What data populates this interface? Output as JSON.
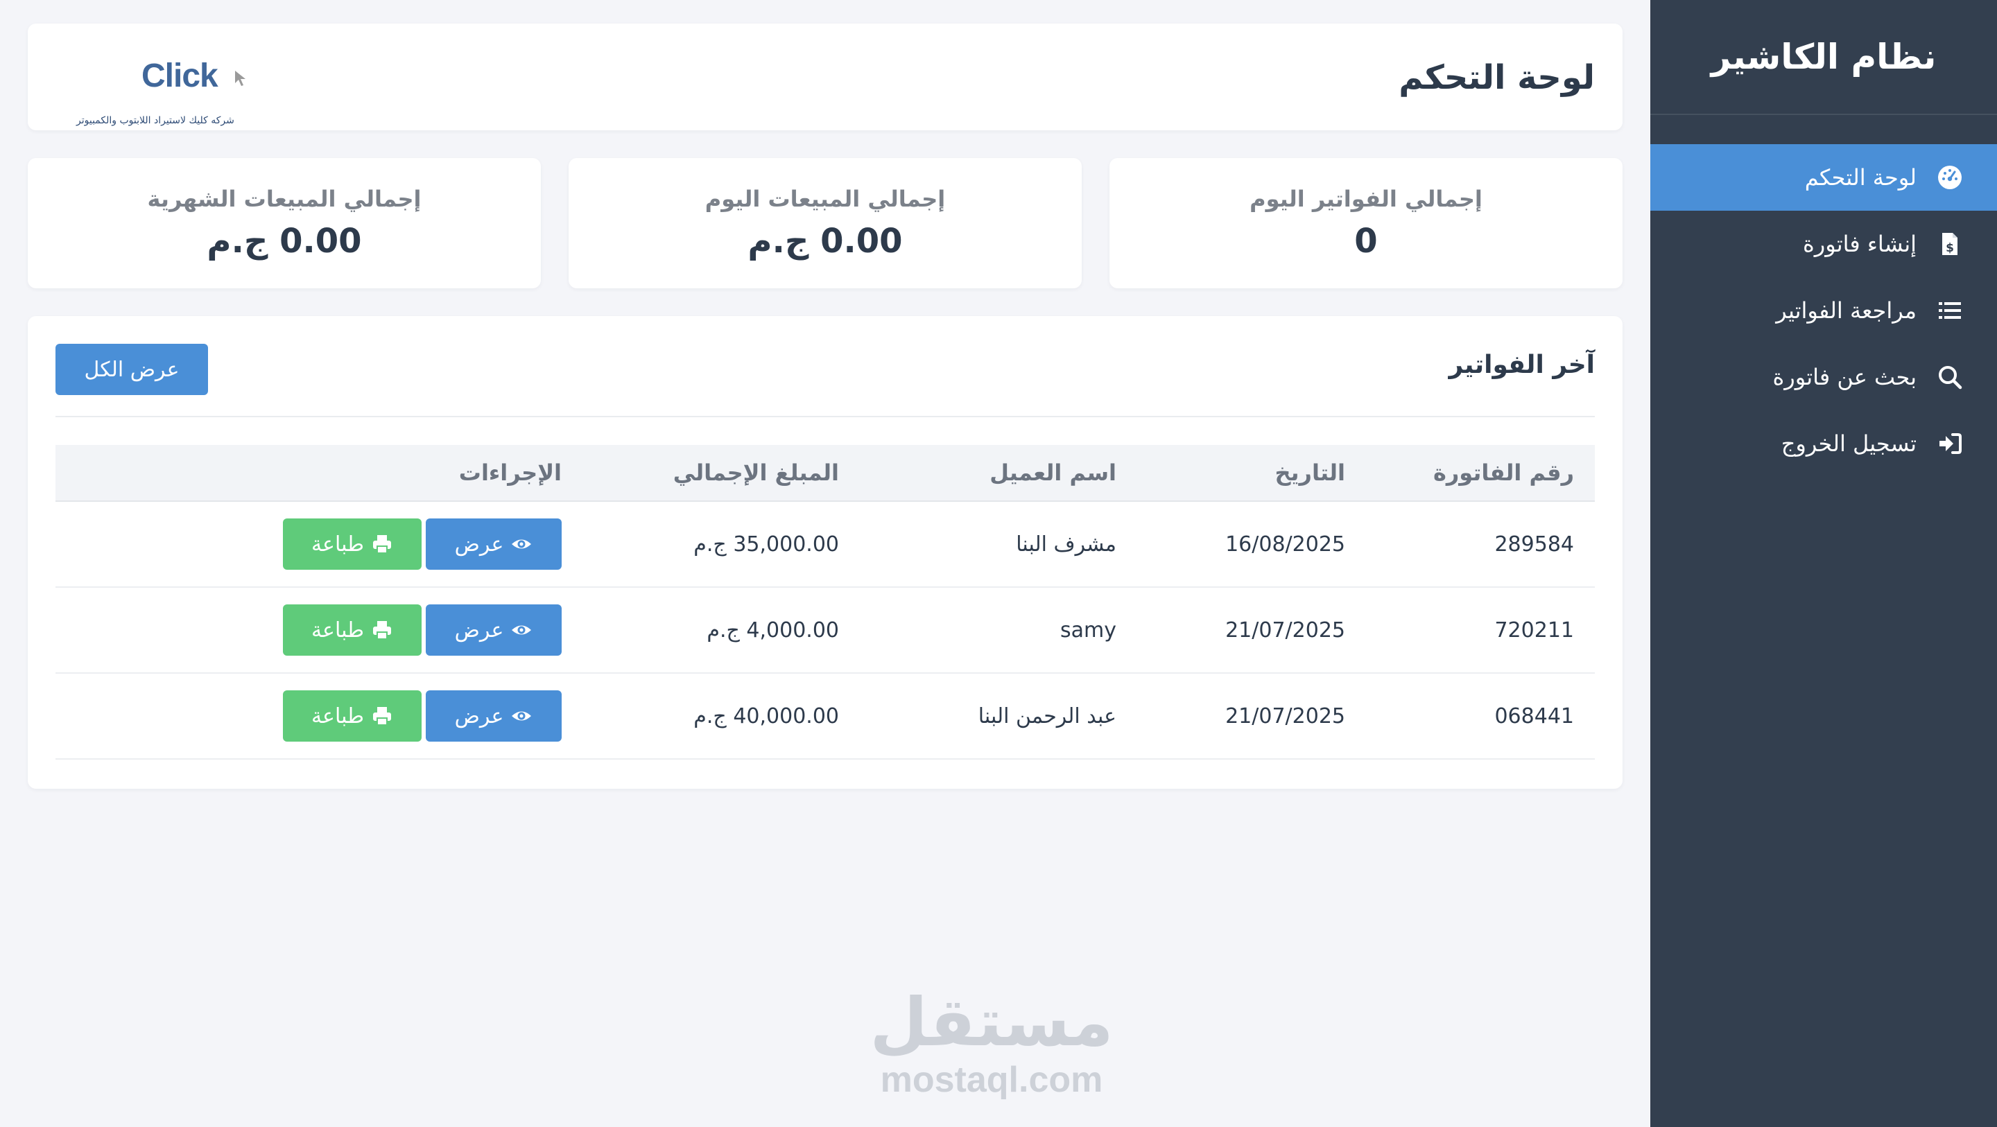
{
  "sidebar": {
    "title": "نظام الكاشير",
    "items": [
      {
        "label": "لوحة التحكم",
        "icon": "dashboard-gauge-icon",
        "active": true
      },
      {
        "label": "إنشاء فاتورة",
        "icon": "invoice-dollar-icon",
        "active": false
      },
      {
        "label": "مراجعة الفواتير",
        "icon": "list-icon",
        "active": false
      },
      {
        "label": "بحث عن فاتورة",
        "icon": "search-icon",
        "active": false
      },
      {
        "label": "تسجيل الخروج",
        "icon": "logout-icon",
        "active": false
      }
    ]
  },
  "header": {
    "title": "لوحة التحكم",
    "logo": {
      "word": "Click",
      "subtitle": "شركه كليك لاستيراد اللابتوب والكمبيوتر"
    }
  },
  "stats": [
    {
      "label": "إجمالي الفواتير اليوم",
      "value": "0"
    },
    {
      "label": "إجمالي المبيعات اليوم",
      "value": "0.00 ج.م"
    },
    {
      "label": "إجمالي المبيعات الشهرية",
      "value": "0.00 ج.م"
    }
  ],
  "invoices": {
    "title": "آخر الفواتير",
    "view_all_label": "عرض الكل",
    "columns": [
      "رقم الفاتورة",
      "التاريخ",
      "اسم العميل",
      "المبلغ الإجمالي",
      "الإجراءات"
    ],
    "rows": [
      {
        "number": "289584",
        "date": "16/08/2025",
        "client": "مشرف البنا",
        "amount": "35,000.00 ج.م"
      },
      {
        "number": "720211",
        "date": "21/07/2025",
        "client": "samy",
        "amount": "4,000.00 ج.م"
      },
      {
        "number": "068441",
        "date": "21/07/2025",
        "client": "عبد الرحمن البنا",
        "amount": "40,000.00 ج.م"
      }
    ],
    "view_label": "عرض",
    "print_label": "طباعة"
  },
  "watermark": {
    "arabic": "مستقل",
    "latin": "mostaql.com"
  },
  "colors": {
    "sidebar_bg": "#333f4f",
    "accent_blue": "#4a8fd7",
    "print_green": "#5fcb7a",
    "page_bg": "#f4f5f9"
  }
}
